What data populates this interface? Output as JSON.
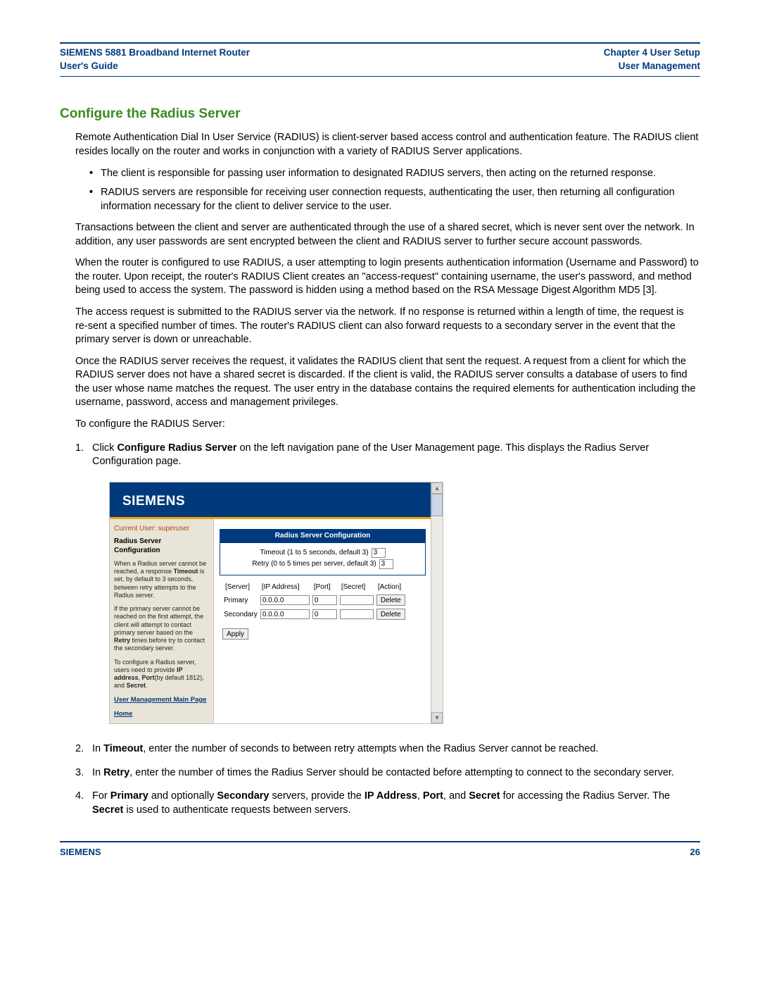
{
  "header": {
    "left_line1": "SIEMENS 5881 Broadband Internet Router",
    "left_line2": "User's Guide",
    "right_line1": "Chapter 4  User Setup",
    "right_line2": "User Management"
  },
  "section_title": "Configure the Radius Server",
  "intro": "Remote Authentication Dial In User Service (RADIUS) is client-server based access control and authentication feature. The RADIUS client resides locally on the router and works in conjunction with a variety of RADIUS Server applications.",
  "bullets": [
    "The client is responsible for passing user information to designated RADIUS servers, then acting on the returned response.",
    "RADIUS servers are responsible for receiving user connection requests, authenticating the user, then returning all configuration information necessary for the client to deliver service to the user."
  ],
  "para2": "Transactions between the client and server are authenticated through the use of a shared secret, which is never sent over the network. In addition, any user passwords are sent encrypted between the client and RADIUS server to further secure account passwords.",
  "para3": "When the router is configured to use RADIUS, a user attempting to login presents authentication information (Username and Password) to the router. Upon receipt, the router's RADIUS Client creates an \"access-request\" containing username, the user's password, and method being used to access the system. The password is hidden using a method based on the RSA Message Digest Algorithm MD5 [3].",
  "para4": "The access request is submitted to the RADIUS server via the network. If no response is returned within a length of time, the request is re-sent a specified number of times. The router's RADIUS client can also forward requests to a secondary server in the event that the primary server is down or unreachable.",
  "para5": "Once the RADIUS server receives the request, it validates the RADIUS client that sent the request. A request from a client for which the RADIUS server does not have a shared secret is discarded. If the client is valid, the RADIUS server consults a database of users to find the user whose name matches the request. The user entry in the database contains the required elements for authentication including the username, password, access and management privileges.",
  "para6": "To configure the RADIUS Server:",
  "step1_a": "Click ",
  "step1_bold": "Configure Radius Server",
  "step1_b": " on the left navigation pane of the User Management page. This displays the Radius Server Configuration page.",
  "step2_a": "In ",
  "step2_bold": "Timeout",
  "step2_b": ", enter the number of seconds to between retry attempts when the Radius Server cannot be reached.",
  "step3_a": "In ",
  "step3_bold": "Retry",
  "step3_b": ", enter the number of times the Radius Server should be contacted before attempting to connect to the secondary server.",
  "step4_a": "For ",
  "step4_b1": "Primary",
  "step4_c": " and optionally ",
  "step4_b2": "Secondary",
  "step4_d": " servers, provide the ",
  "step4_b3": "IP Address",
  "step4_e": ", ",
  "step4_b4": "Port",
  "step4_f": ", and ",
  "step4_b5": "Secret",
  "step4_g": " for accessing the Radius Server. The ",
  "step4_b6": "Secret",
  "step4_h": " is used to authenticate requests between servers.",
  "figure": {
    "brand": "SIEMENS",
    "current_user": "Current User: superuser",
    "left_title": "Radius Server Configuration",
    "left_note1_a": "When a Radius server cannot be reached, a response ",
    "left_note1_bold": "Timeout",
    "left_note1_b": " is set, by default to 3 seconds, between retry attempts to the Radius server.",
    "left_note2_a": "If the primary server cannot be reached on the first attempt, the client will attempt to contact primary server based on the ",
    "left_note2_bold": "Retry",
    "left_note2_b": " times before try to contact the secondary server.",
    "left_note3_a": "To configure a Radius server, users need to provide ",
    "left_note3_b1": "IP address",
    "left_note3_c": ", ",
    "left_note3_b2": "Port",
    "left_note3_d": "(by default 1812), and ",
    "left_note3_b3": "Secret",
    "left_note3_e": ".",
    "left_link1": "User Management Main Page",
    "left_link2": "Home",
    "config_header": "Radius Server Configuration",
    "timeout_label": "Timeout (1 to 5 seconds, default 3)",
    "timeout_value": "3",
    "retry_label": "Retry (0 to 5 times per server, default 3)",
    "retry_value": "3",
    "cols": {
      "server": "[Server]",
      "ip": "[IP Address]",
      "port": "[Port]",
      "secret": "[Secret]",
      "action": "[Action]"
    },
    "rows": [
      {
        "server": "Primary",
        "ip": "0.0.0.0",
        "port": "0",
        "secret": "",
        "action": "Delete"
      },
      {
        "server": "Secondary",
        "ip": "0.0.0.0",
        "port": "0",
        "secret": "",
        "action": "Delete"
      }
    ],
    "apply": "Apply"
  },
  "footer": {
    "left": "SIEMENS",
    "right": "26"
  }
}
